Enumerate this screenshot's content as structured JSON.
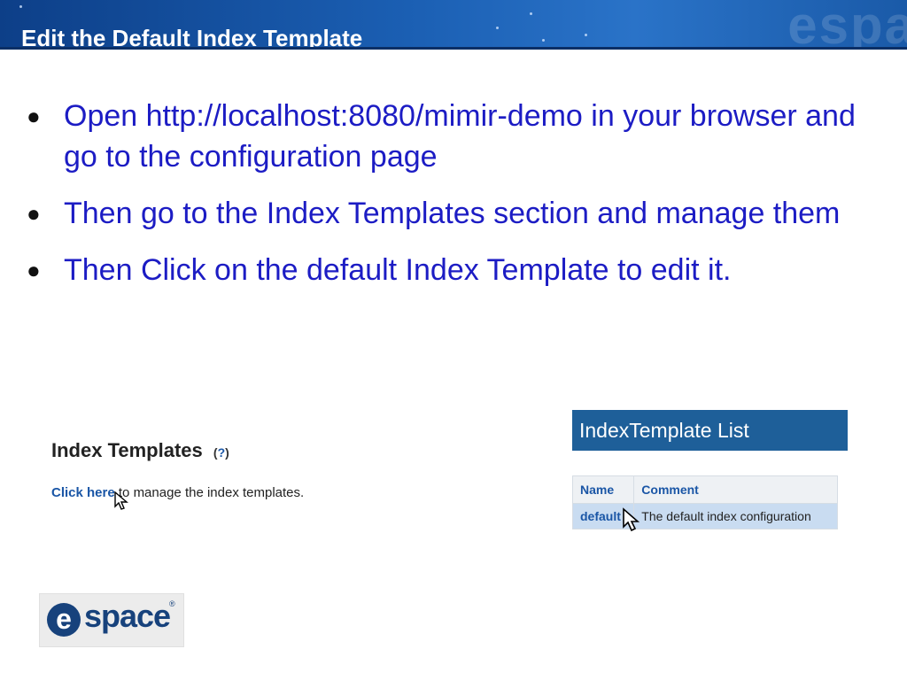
{
  "slide": {
    "title": "Edit the Default Index Template",
    "bullets": [
      "Open http://localhost:8080/mimir-demo in your browser and go to the configuration page",
      "Then go to the Index Templates section and manage them",
      "Then Click on the default Index Template to edit it."
    ]
  },
  "index_templates_panel": {
    "heading": "Index Templates",
    "help_open": "(",
    "help_q": "?",
    "help_close": ")",
    "link_text": "Click here",
    "line_rest": " to manage the index templates."
  },
  "index_template_list": {
    "header": "IndexTemplate List",
    "columns": [
      "Name",
      "Comment"
    ],
    "rows": [
      {
        "name": "default",
        "comment": "The default index configuration"
      }
    ]
  },
  "logo": {
    "letter": "e",
    "text": "space",
    "mark": "®"
  },
  "colors": {
    "banner": "#1b5fb3",
    "bullet_text": "#1c1cc4",
    "list_header": "#1e5f99",
    "link": "#1a56a6"
  }
}
